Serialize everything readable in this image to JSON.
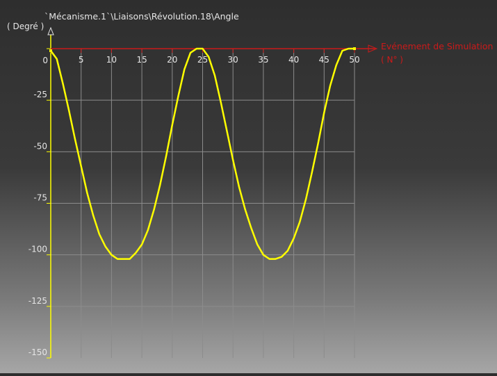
{
  "chart_data": {
    "type": "line",
    "title": "`Mécanisme.1`\\Liaisons\\Révolution.18\\Angle",
    "ylabel": "( Degré )",
    "xlabel": "Evénement de Simulation",
    "xunit": "( N° )",
    "xlim": [
      0,
      50
    ],
    "ylim": [
      -150,
      0
    ],
    "x_ticks": [
      0,
      5,
      10,
      15,
      20,
      25,
      30,
      35,
      40,
      45,
      50
    ],
    "x_tick_labels": [
      "0",
      "5",
      "10",
      "15",
      "20",
      "25",
      "30",
      "35",
      "40",
      "45",
      "50"
    ],
    "y_ticks": [
      0,
      -25,
      -50,
      -75,
      -100,
      -125,
      -150
    ],
    "y_tick_labels": [
      "0",
      "-25",
      "-50",
      "-75",
      "-100",
      "-125",
      "-150"
    ],
    "grid": true,
    "series": [
      {
        "color": "#ffff00",
        "x": [
          0,
          1,
          2,
          3,
          4,
          5,
          6,
          7,
          8,
          9,
          10,
          11,
          12,
          13,
          14,
          15,
          16,
          17,
          18,
          19,
          20,
          21,
          22,
          23,
          24,
          25,
          26,
          27,
          28,
          29,
          30,
          31,
          32,
          33,
          34,
          35,
          36,
          37,
          38,
          39,
          40,
          41,
          42,
          43,
          44,
          45,
          46,
          47,
          48,
          49,
          50
        ],
        "values": [
          -1,
          -5,
          -17,
          -30,
          -44,
          -57,
          -70,
          -81,
          -90,
          -96,
          -100,
          -102,
          -102,
          -102,
          -99,
          -95,
          -88,
          -78,
          -66,
          -52,
          -37,
          -23,
          -10,
          -2,
          0,
          0,
          -4,
          -13,
          -26,
          -40,
          -54,
          -67,
          -78,
          -87,
          -95,
          -100,
          -102,
          -102,
          -101,
          -98,
          -92,
          -84,
          -73,
          -60,
          -46,
          -31,
          -18,
          -8,
          -1,
          0,
          0
        ]
      }
    ],
    "colors": {
      "axis": "#ffff00",
      "x_axis_line": "#cc1a1a",
      "x_axis_label": "#cc1a1a",
      "grid": "#8c8c8c",
      "text": "#e6e6e6"
    }
  }
}
